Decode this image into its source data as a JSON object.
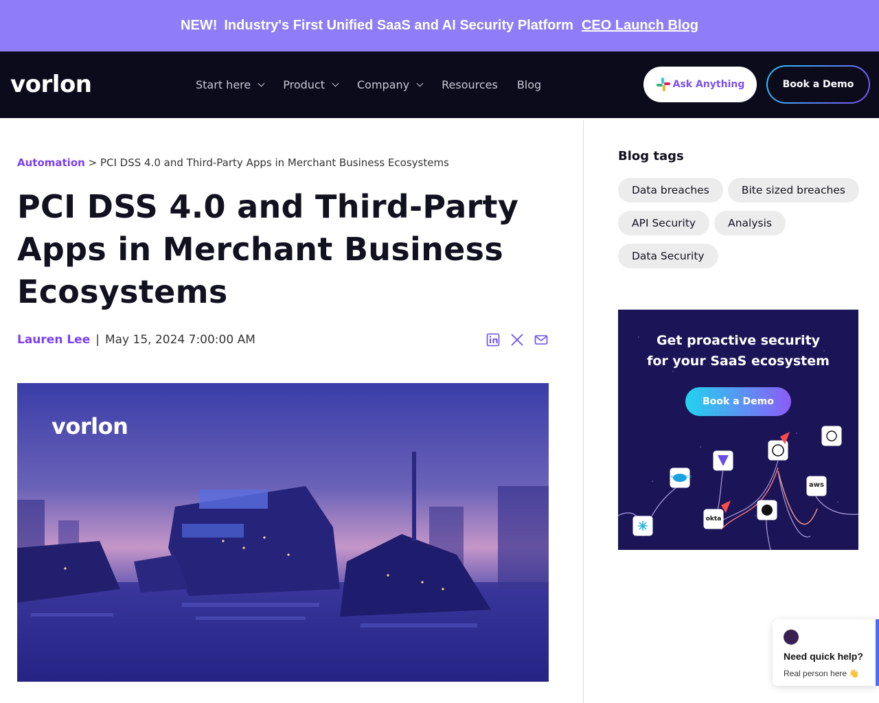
{
  "banner": {
    "new_label": "NEW!",
    "headline": "Industry's First Unified SaaS and AI Security Platform",
    "link": "CEO Launch Blog"
  },
  "header": {
    "logo": "vorlon",
    "nav": [
      {
        "label": "Start here",
        "has_dropdown": true
      },
      {
        "label": "Product",
        "has_dropdown": true
      },
      {
        "label": "Company",
        "has_dropdown": true
      },
      {
        "label": "Resources",
        "has_dropdown": false
      },
      {
        "label": "Blog",
        "has_dropdown": false
      }
    ],
    "ask_button": "Ask Anything",
    "demo_button": "Book a Demo"
  },
  "article": {
    "breadcrumb_parent": "Automation",
    "breadcrumb_separator": ">",
    "breadcrumb_current": "PCI DSS 4.0 and Third-Party Apps in Merchant Business Ecosystems",
    "title": "PCI DSS 4.0 and Third-Party Apps in Merchant Business Ecosystems",
    "author": "Lauren Lee",
    "meta_separator": "|",
    "date": "May 15, 2024 7:00:00 AM",
    "share_icons": [
      "linkedin-icon",
      "x-icon",
      "email-icon"
    ],
    "hero_logo": "vorlon"
  },
  "sidebar": {
    "tags_title": "Blog tags",
    "tags": [
      "Data breaches",
      "Bite sized breaches",
      "API Security",
      "Analysis",
      "Data Security"
    ],
    "promo": {
      "headline_line1": "Get proactive security",
      "headline_line2": "for your SaaS ecosystem",
      "button": "Book a Demo",
      "app_labels": [
        "salesforce",
        "okta",
        "aws"
      ]
    }
  },
  "help_widget": {
    "title": "Need quick help?",
    "subtitle": "Real person here 👋"
  },
  "colors": {
    "banner": "#8e7df7",
    "header_bg": "#0c0b1c",
    "accent_purple": "#7b3ff0"
  }
}
